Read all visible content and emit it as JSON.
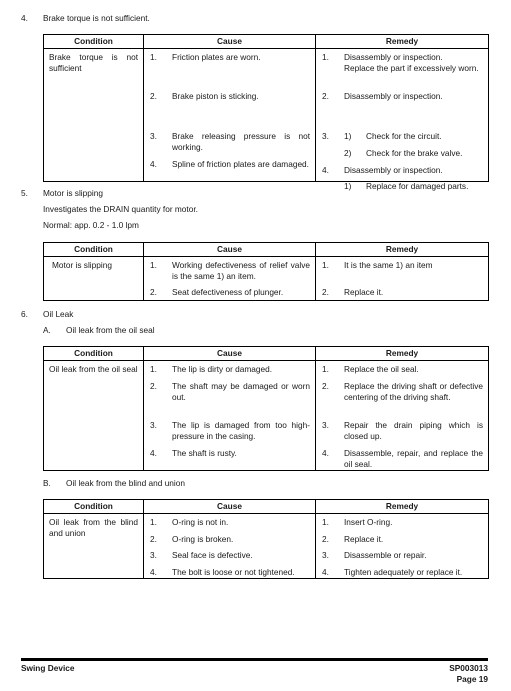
{
  "headers": {
    "condition": "Condition",
    "cause": "Cause",
    "remedy": "Remedy"
  },
  "section4": {
    "number": "4.",
    "title": "Brake torque is not sufficient.",
    "condition": "Brake torque is not sufficient",
    "causes": [
      {
        "num": "1.",
        "text": "Friction plates are worn."
      },
      {
        "num": "2.",
        "text": "Brake piston is sticking."
      },
      {
        "num": "3.",
        "text": "Brake releasing pressure is not working."
      },
      {
        "num": "4.",
        "text": "Spline of friction plates are damaged."
      }
    ],
    "remedies": [
      {
        "num": "1.",
        "text": "Disassembly or inspection.",
        "text2": "Replace the part if excessively worn."
      },
      {
        "num": "2.",
        "text": "Disassembly or inspection."
      },
      {
        "num": "3.",
        "sub": [
          {
            "num": "1)",
            "text": "Check for the circuit."
          },
          {
            "num": "2)",
            "text": "Check for the brake valve."
          }
        ]
      },
      {
        "num": "4.",
        "text": "Disassembly or inspection.",
        "sub": [
          {
            "num": "1)",
            "text": "Replace for damaged parts."
          }
        ]
      }
    ]
  },
  "section5": {
    "number": "5.",
    "title": "Motor is slipping",
    "line1": "Investigates the DRAIN quantity for motor.",
    "line2": "Normal: app. 0.2 - 1.0 lpm",
    "condition": "Motor is slipping",
    "causes": [
      {
        "num": "1.",
        "text": "Working defectiveness of relief valve is the same 1) an item."
      },
      {
        "num": "2.",
        "text": "Seat defectiveness of plunger."
      }
    ],
    "remedies": [
      {
        "num": "1.",
        "text": "It is the same 1) an item"
      },
      {
        "num": "2.",
        "text": "Replace it."
      }
    ]
  },
  "section6": {
    "number": "6.",
    "title": "Oil Leak",
    "subA": {
      "letter": "A.",
      "title": "Oil leak from the oil seal",
      "condition": "Oil leak from the oil seal",
      "causes": [
        {
          "num": "1.",
          "text": "The lip is dirty or damaged."
        },
        {
          "num": "2.",
          "text": "The shaft may be damaged or worn out."
        },
        {
          "num": "3.",
          "text": "The lip is damaged from too high-pressure in the casing."
        },
        {
          "num": "4.",
          "text": "The shaft is rusty."
        }
      ],
      "remedies": [
        {
          "num": "1.",
          "text": "Replace the oil seal."
        },
        {
          "num": "2.",
          "text": "Replace the driving shaft or defective centering of the driving shaft."
        },
        {
          "num": "3.",
          "text": "Repair the drain piping which is closed up."
        },
        {
          "num": "4.",
          "text": "Disassemble, repair, and replace the oil seal."
        }
      ]
    },
    "subB": {
      "letter": "B.",
      "title": "Oil leak from the blind and union",
      "condition": "Oil leak from the blind and union",
      "causes": [
        {
          "num": "1.",
          "text": "O-ring is not in."
        },
        {
          "num": "2.",
          "text": "O-ring is broken."
        },
        {
          "num": "3.",
          "text": "Seal face is defective."
        },
        {
          "num": "4.",
          "text": "The bolt is loose or not tightened."
        }
      ],
      "remedies": [
        {
          "num": "1.",
          "text": "Insert O-ring."
        },
        {
          "num": "2.",
          "text": "Replace it."
        },
        {
          "num": "3.",
          "text": "Disassemble or repair."
        },
        {
          "num": "4.",
          "text": "Tighten adequately or replace it."
        }
      ]
    }
  },
  "footer": {
    "left": "Swing Device",
    "doc_id": "SP003013",
    "page": "Page 19"
  }
}
